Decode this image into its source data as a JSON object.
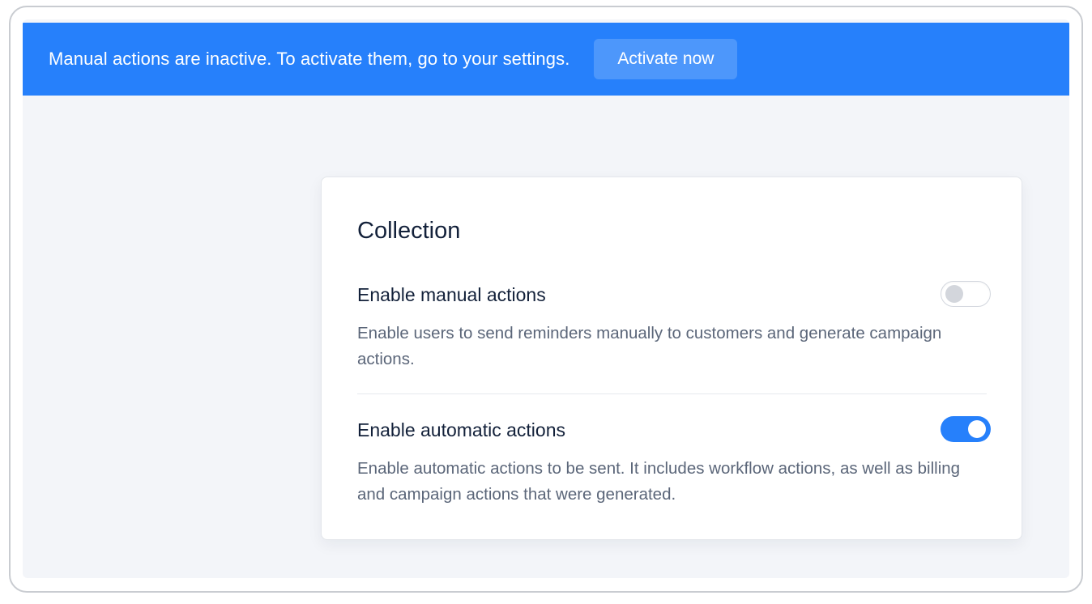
{
  "banner": {
    "message": "Manual actions are inactive. To activate them, go to your settings.",
    "button_label": "Activate now"
  },
  "card": {
    "title": "Collection",
    "settings": [
      {
        "label": "Enable manual actions",
        "description": "Enable users to send reminders manually to customers and generate campaign actions.",
        "enabled": false
      },
      {
        "label": "Enable automatic actions",
        "description": "Enable automatic actions to be sent. It includes workflow actions, as well as billing and campaign actions that were generated.",
        "enabled": true
      }
    ]
  },
  "colors": {
    "accent": "#2680fb",
    "background": "#f3f5f9",
    "text_primary": "#13213a",
    "text_secondary": "#5b6679"
  }
}
